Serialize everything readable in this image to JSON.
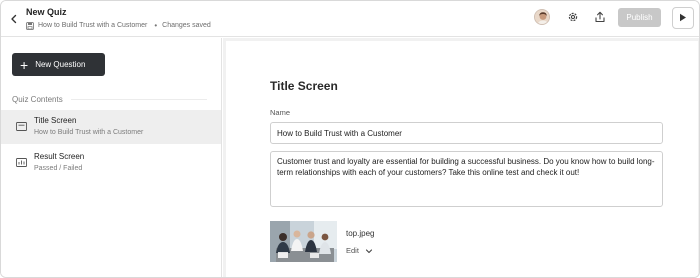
{
  "header": {
    "title": "New Quiz",
    "course": "How to Build Trust with a Customer",
    "separator": "•",
    "status": "Changes saved",
    "publish_label": "Publish",
    "icons": [
      "back-arrow-icon",
      "save-icon",
      "avatar",
      "gear-icon",
      "share-icon",
      "play-icon"
    ]
  },
  "sidebar": {
    "new_question_label": "New Question",
    "section_label": "Quiz Contents",
    "items": [
      {
        "title": "Title Screen",
        "subtitle": "How to Build Trust with a Customer",
        "icon": "screen-icon"
      },
      {
        "title": "Result Screen",
        "subtitle": "Passed / Failed",
        "icon": "results-chart-icon"
      }
    ]
  },
  "main": {
    "heading": "Title Screen",
    "name_label": "Name",
    "name_value": "How to Build Trust with a Customer",
    "description": "Customer trust and loyalty are essential for building a successful business. Do you know how to build long-term relationships with each of your customers? Take this online test and check it out!",
    "image_filename": "top.jpeg",
    "edit_label": "Edit"
  },
  "colors": {
    "dark_button": "#2f3236",
    "publish_disabled": "#c8c8c8",
    "active_item": "#eeeeee",
    "canvas_bg": "#f1f1f1"
  }
}
